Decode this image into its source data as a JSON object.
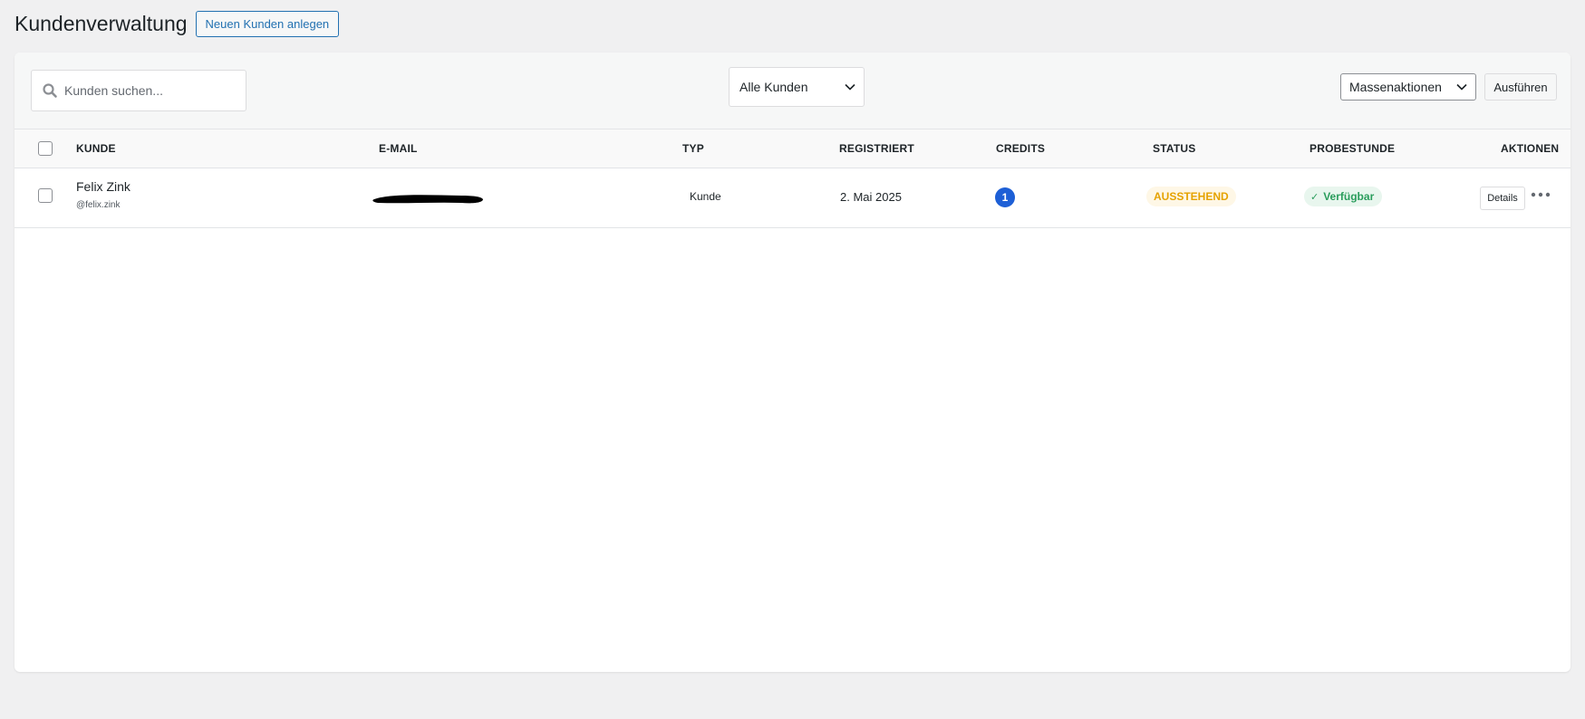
{
  "page": {
    "title": "Kundenverwaltung",
    "add_button": "Neuen Kunden anlegen"
  },
  "toolbar": {
    "search_placeholder": "Kunden suchen...",
    "filter_selected": "Alle Kunden",
    "bulk_selected": "Massenaktionen",
    "apply_label": "Ausführen"
  },
  "table": {
    "columns": [
      "Kunde",
      "E-Mail",
      "Typ",
      "Registriert",
      "Credits",
      "Status",
      "Probestunde",
      "Aktionen"
    ],
    "rows": [
      {
        "name": "Felix Zink",
        "username": "@felix.zink",
        "typ": "Kunde",
        "registered": "2. Mai 2025",
        "credits": "1",
        "status": "AUSSTEHEND",
        "trial": "Verfügbar",
        "details_label": "Details"
      }
    ]
  },
  "icons": {
    "search": "search-icon",
    "filter_chevron": "chevron-down-icon",
    "bulk_chevron": "chevron-down-icon",
    "trial_check": "check-icon",
    "row_menu": "more-horizontal-icon"
  },
  "colors": {
    "primary": "#2271b1",
    "credits_badge": "#1d5fd6",
    "status_pending_text": "#e5a200",
    "status_pending_bg": "#fef7e6",
    "trial_text": "#2a9d5c",
    "trial_bg": "#e8f6ee",
    "page_bg": "#f0f0f1"
  }
}
